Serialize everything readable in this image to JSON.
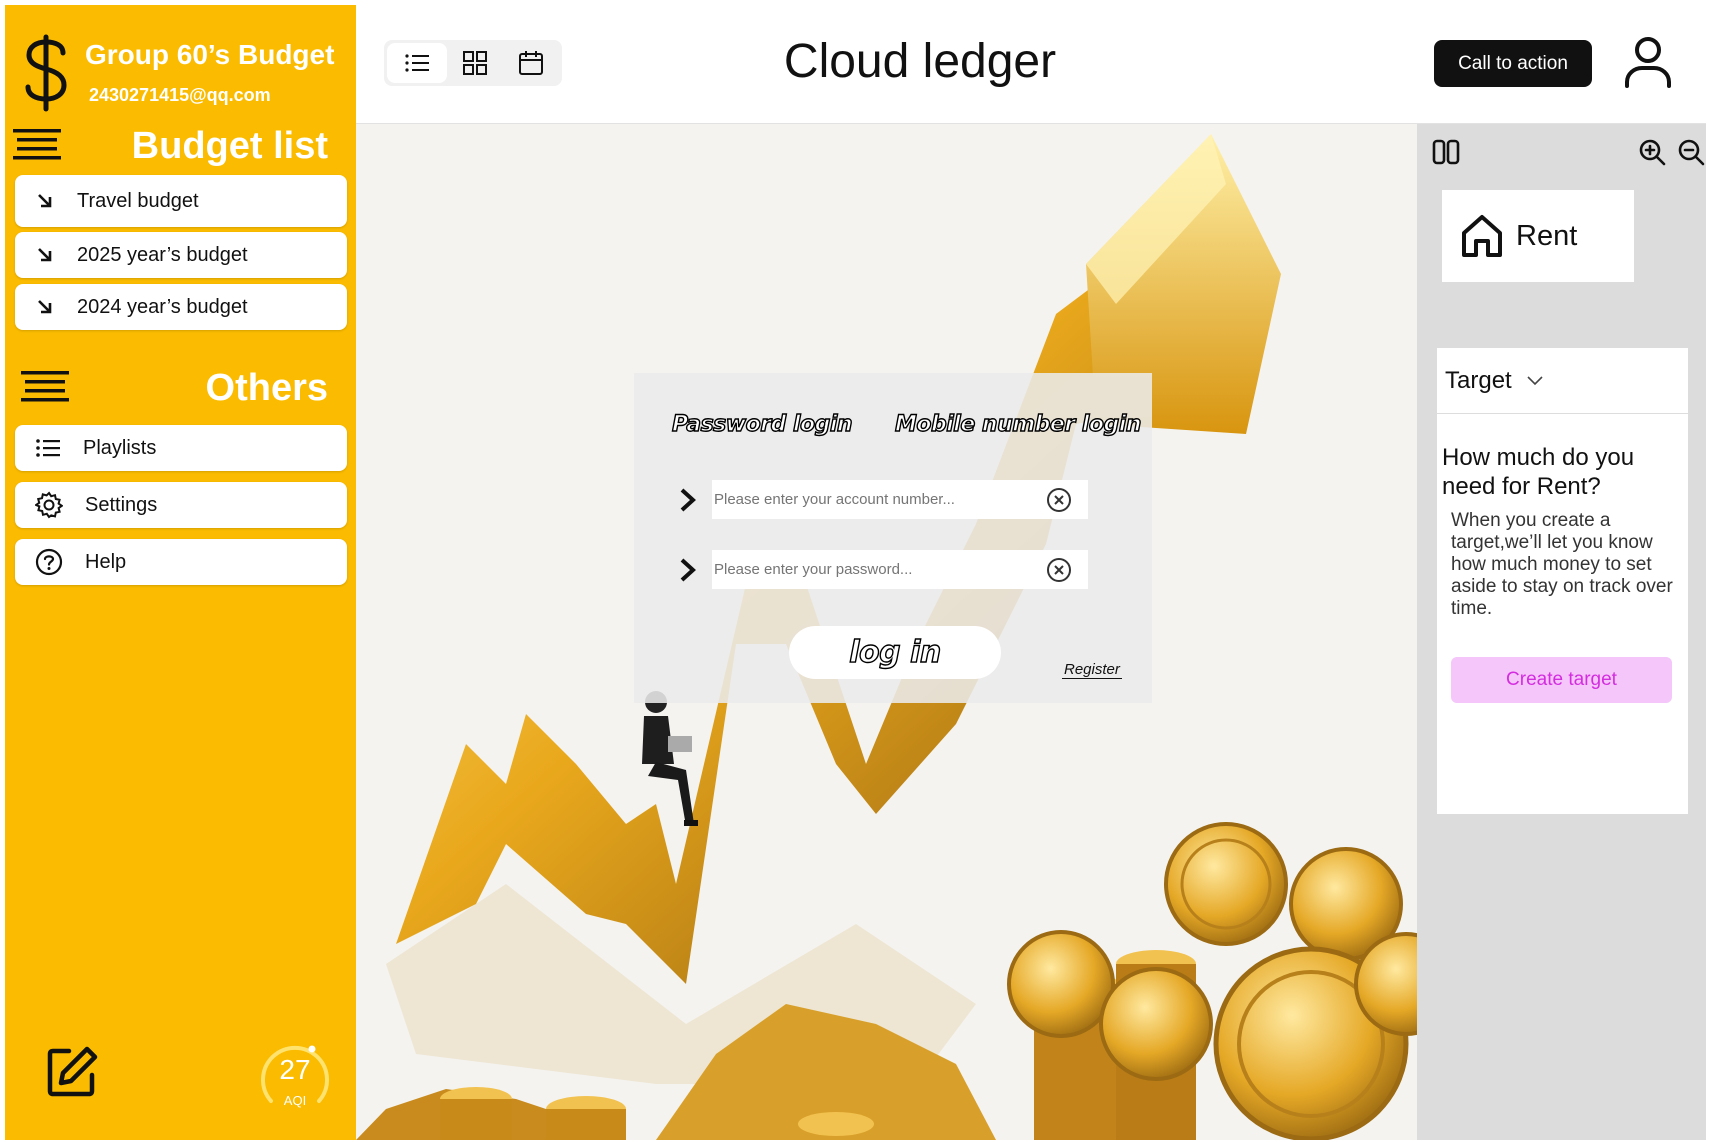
{
  "sidebar": {
    "group_name": "Group 60’s Budget",
    "email": "2430271415@qq.com",
    "budget_section_title": "Budget list",
    "budget_items": [
      {
        "label": "Travel budget"
      },
      {
        "label": "2025 year’s budget"
      },
      {
        "label": "2024 year’s budget"
      }
    ],
    "others_section_title": "Others",
    "other_items": [
      {
        "label": "Playlists",
        "icon": "list-icon"
      },
      {
        "label": "Settings",
        "icon": "gear-icon"
      },
      {
        "label": "Help",
        "icon": "help-icon"
      }
    ],
    "aqi": {
      "value": "27",
      "label": "AQI"
    }
  },
  "header": {
    "title": "Cloud ledger",
    "cta_label": "Call to action"
  },
  "login": {
    "tab_password": "Password login",
    "tab_mobile": "Mobile number login",
    "account_placeholder": "Please enter your account number...",
    "password_placeholder": "Please enter your password...",
    "login_label": "log in",
    "register_label": "Register"
  },
  "right_panel": {
    "rent_label": "Rent",
    "target_dropdown": "Target",
    "question": "How much do you need for Rent?",
    "description": "When you create a target,we’ll let you know how much money to set aside to stay on track over time.",
    "create_button": "Create target"
  },
  "colors": {
    "sidebar": "#FABB00",
    "cta": "#111111",
    "create_target_bg": "#F4C6F9",
    "create_target_text": "#D42DE0"
  }
}
